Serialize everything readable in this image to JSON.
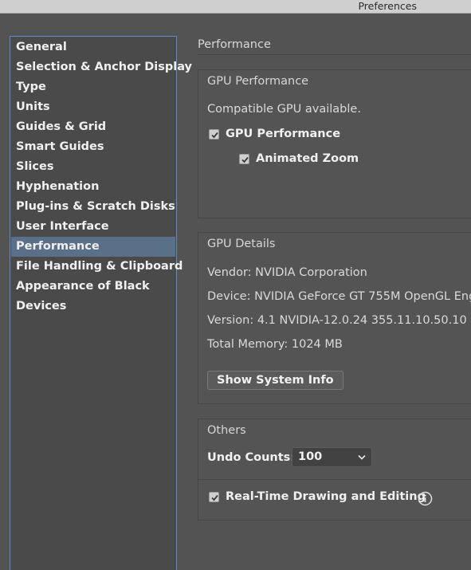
{
  "window": {
    "title": "Preferences"
  },
  "sidebar": {
    "items": [
      {
        "label": "General",
        "selected": false
      },
      {
        "label": "Selection & Anchor Display",
        "selected": false
      },
      {
        "label": "Type",
        "selected": false
      },
      {
        "label": "Units",
        "selected": false
      },
      {
        "label": "Guides & Grid",
        "selected": false
      },
      {
        "label": "Smart Guides",
        "selected": false
      },
      {
        "label": "Slices",
        "selected": false
      },
      {
        "label": "Hyphenation",
        "selected": false
      },
      {
        "label": "Plug-ins & Scratch Disks",
        "selected": false
      },
      {
        "label": "User Interface",
        "selected": false
      },
      {
        "label": "Performance",
        "selected": true
      },
      {
        "label": "File Handling & Clipboard",
        "selected": false
      },
      {
        "label": "Appearance of Black",
        "selected": false
      },
      {
        "label": "Devices",
        "selected": false
      }
    ]
  },
  "main": {
    "title": "Performance",
    "gpu_performance": {
      "title": "GPU Performance",
      "status": "Compatible GPU available.",
      "gpu_performance_label": "GPU Performance",
      "gpu_performance_checked": true,
      "animated_zoom_label": "Animated Zoom",
      "animated_zoom_checked": true
    },
    "gpu_details": {
      "title": "GPU Details",
      "vendor": "Vendor: NVIDIA Corporation",
      "device": "Device: NVIDIA GeForce GT 755M OpenGL Eng",
      "version": "Version: 4.1 NVIDIA-12.0.24 355.11.10.50.10",
      "total_memory": "Total Memory: 1024 MB",
      "show_system_info_label": "Show System Info"
    },
    "others": {
      "title": "Others",
      "undo_counts_label": "Undo Counts:",
      "undo_counts_value": "100",
      "realtime_label": "Real-Time Drawing and Editing",
      "realtime_checked": true
    }
  },
  "colors": {
    "background": "#535353",
    "selection": "#5a6f88",
    "sidebar_border": "#5d8dc9"
  },
  "icons": {
    "checkbox": "check-icon",
    "dropdown": "chevron-down-icon",
    "info": "info-icon"
  }
}
